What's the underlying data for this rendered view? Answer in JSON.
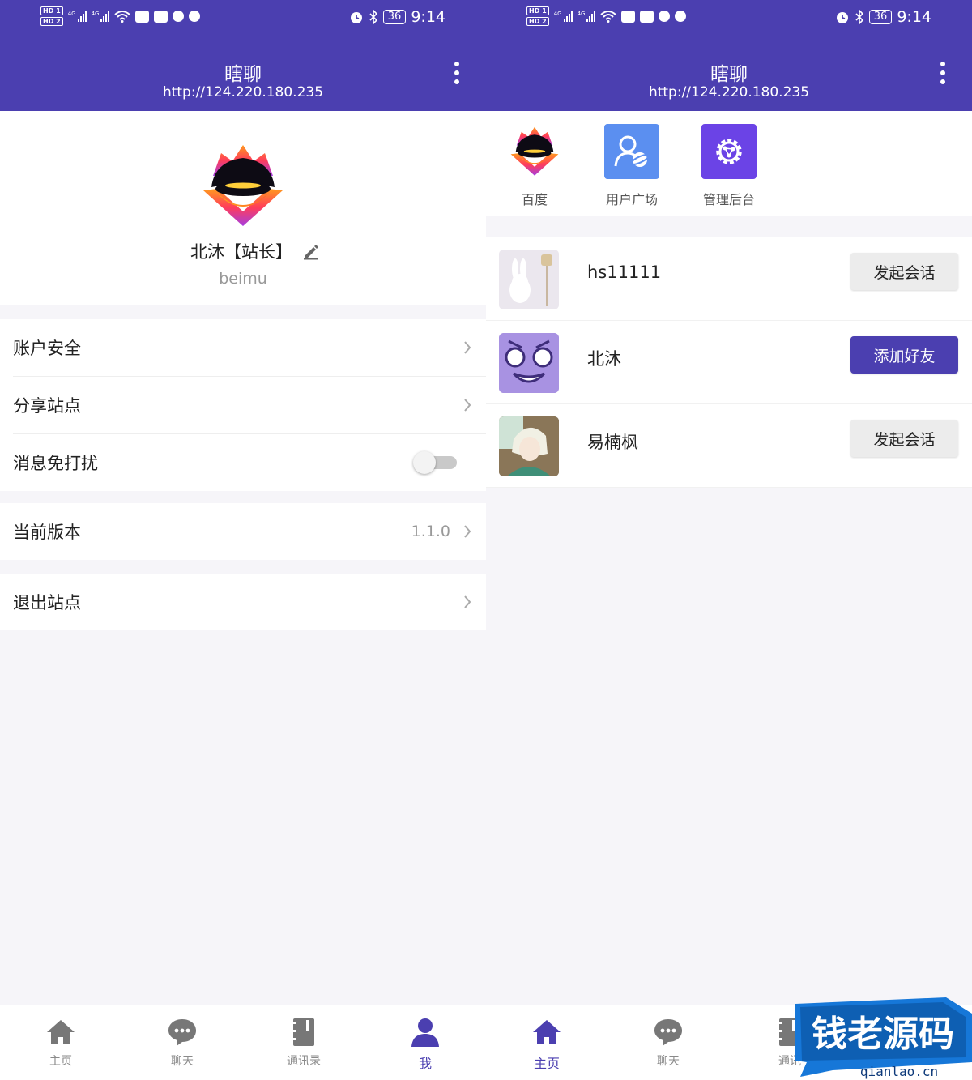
{
  "status_bar": {
    "hd1": "HD 1",
    "hd2": "HD 2",
    "net1": "4G",
    "net2": "4G",
    "battery": "36",
    "time": "9:14"
  },
  "app_bar": {
    "title": "瞎聊",
    "url": "http://124.220.180.235"
  },
  "profile": {
    "name": "北沐【站长】",
    "handle": "beimu"
  },
  "settings": {
    "account_security": "账户安全",
    "share_site": "分享站点",
    "do_not_disturb": "消息免打扰",
    "current_version": "当前版本",
    "version_value": "1.1.0",
    "exit_site": "退出站点"
  },
  "shortcuts": [
    {
      "label": "百度"
    },
    {
      "label": "用户广场"
    },
    {
      "label": "管理后台"
    }
  ],
  "users": [
    {
      "name": "hs11111",
      "action": "发起会话"
    },
    {
      "name": "北沐",
      "action": "添加好友"
    },
    {
      "name": "易楠枫",
      "action": "发起会话"
    }
  ],
  "nav": {
    "home": "主页",
    "chat": "聊天",
    "contacts": "通讯录",
    "me": "我",
    "contacts_truncated": "通讯"
  },
  "watermark": {
    "title": "钱老源码",
    "domain": "qianlao.cn"
  },
  "colors": {
    "brand": "#4b3fb0",
    "shortcut_user_square": "#5b8ff0",
    "shortcut_admin": "#6b43e6",
    "watermark_blue": "#1677d8"
  },
  "states": {
    "do_not_disturb_enabled": false,
    "left_active_tab": "我",
    "right_active_tab": "主页"
  }
}
